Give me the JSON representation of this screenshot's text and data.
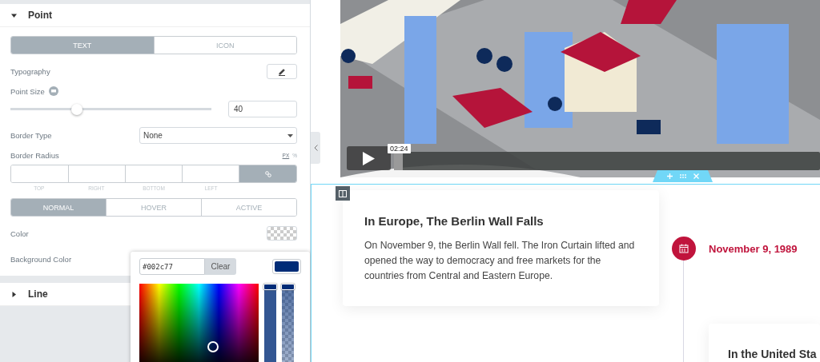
{
  "point_section": {
    "title": "Point",
    "expanded": true
  },
  "type_tabs": [
    {
      "label": "TEXT",
      "selected": true
    },
    {
      "label": "ICON",
      "selected": false
    }
  ],
  "typography": {
    "label": "Typography"
  },
  "point_size": {
    "label": "Point Size",
    "level": 0.33,
    "value": "40"
  },
  "border_type": {
    "label": "Border Type",
    "value": "None"
  },
  "border_radius": {
    "label": "Border Radius",
    "units": [
      {
        "label": "PX",
        "selected": true
      },
      {
        "label": "%",
        "selected": false
      }
    ],
    "sides": [
      "TOP",
      "RIGHT",
      "BOTTOM",
      "LEFT"
    ],
    "linked": true
  },
  "state_tabs": [
    {
      "label": "NORMAL",
      "selected": true
    },
    {
      "label": "HOVER",
      "selected": false
    },
    {
      "label": "ACTIVE",
      "selected": false
    }
  ],
  "color": {
    "label": "Color"
  },
  "background_color": {
    "label": "Background Color"
  },
  "color_picker": {
    "value": "#002c77",
    "clear": "Clear",
    "color": "#002c77",
    "hue": {
      "level": 1
    },
    "alpha": {
      "level": 1
    }
  },
  "line_section": {
    "title": "Line",
    "expanded": false
  },
  "video": {
    "time": "02:24",
    "level": 0.02
  },
  "timeline": [
    {
      "title": "In Europe, The Berlin Wall Falls",
      "body": "On November 9, the Berlin Wall fell. The Iron Curtain lifted and opened the way to democracy and free markets for the countries from Central and Eastern Europe.",
      "date": "November 9, 1989"
    },
    {
      "title": "In the United Sta"
    }
  ]
}
